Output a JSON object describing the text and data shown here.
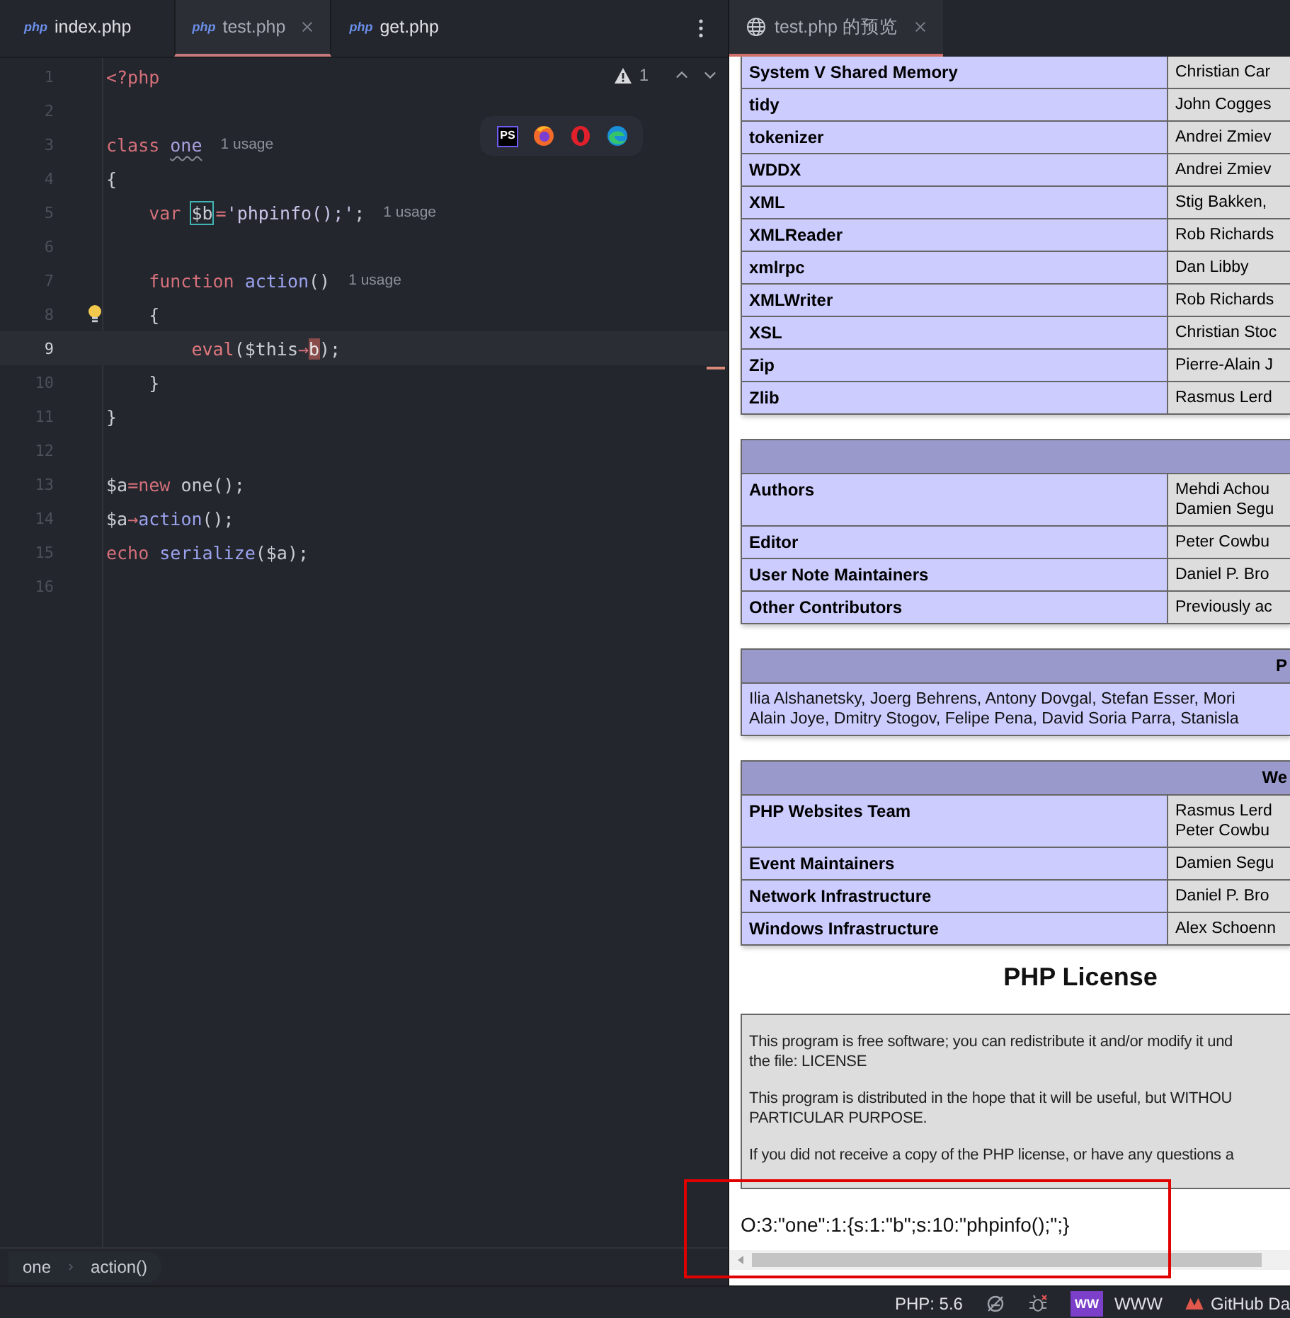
{
  "editor": {
    "tabs": [
      {
        "icon_text": "php",
        "label": "index.php",
        "selected": false,
        "closable": false
      },
      {
        "icon_text": "php",
        "label": "test.php",
        "selected": true,
        "closable": true
      },
      {
        "icon_text": "php",
        "label": "get.php",
        "selected": false,
        "closable": false
      }
    ],
    "inspection": {
      "warnings": "1"
    },
    "browser_toolbar": {
      "phpstorm_label": "PS"
    },
    "lines": [
      {
        "number": "1",
        "selected": false,
        "bulb": false,
        "tokens": [
          {
            "kind": "tag",
            "text": "<?php"
          }
        ]
      },
      {
        "number": "2",
        "selected": false,
        "bulb": false
      },
      {
        "number": "3",
        "selected": false,
        "bulb": false,
        "tokens": [
          {
            "kind": "kw",
            "text": "class "
          },
          {
            "kind": "cls",
            "text": "one"
          },
          {
            "kind": "hint",
            "text": "1 usage"
          }
        ]
      },
      {
        "number": "4",
        "selected": false,
        "bulb": false,
        "tokens": [
          {
            "kind": "plain",
            "text": "{"
          }
        ]
      },
      {
        "number": "5",
        "selected": false,
        "bulb": false,
        "tokens": [
          {
            "kind": "kw",
            "text": "    var "
          },
          {
            "kind": "boxed",
            "text": "$b"
          },
          {
            "kind": "op",
            "text": "="
          },
          {
            "kind": "str",
            "text": "'phpinfo();'"
          },
          {
            "kind": "plain",
            "text": ";"
          },
          {
            "kind": "hint",
            "text": "1 usage"
          }
        ]
      },
      {
        "number": "6",
        "selected": false,
        "bulb": false
      },
      {
        "number": "7",
        "selected": false,
        "bulb": false,
        "tokens": [
          {
            "kind": "kw",
            "text": "    function "
          },
          {
            "kind": "fn",
            "text": "action"
          },
          {
            "kind": "plain",
            "text": "()"
          },
          {
            "kind": "hint",
            "text": "1 usage"
          }
        ]
      },
      {
        "number": "8",
        "selected": false,
        "bulb": true,
        "tokens": [
          {
            "kind": "plain",
            "text": "    {"
          }
        ]
      },
      {
        "number": "9",
        "selected": true,
        "bulb": false,
        "tokens": [
          {
            "kind": "builtin",
            "text": "        eval"
          },
          {
            "kind": "plain",
            "text": "($this"
          },
          {
            "kind": "op",
            "text": "→"
          },
          {
            "kind": "caret",
            "text": "b"
          },
          {
            "kind": "plain",
            "text": ");"
          }
        ]
      },
      {
        "number": "10",
        "selected": false,
        "bulb": false,
        "tokens": [
          {
            "kind": "plain",
            "text": "    }"
          }
        ]
      },
      {
        "number": "11",
        "selected": false,
        "bulb": false,
        "tokens": [
          {
            "kind": "plain",
            "text": "}"
          }
        ]
      },
      {
        "number": "12",
        "selected": false,
        "bulb": false
      },
      {
        "number": "13",
        "selected": false,
        "bulb": false,
        "tokens": [
          {
            "kind": "plain",
            "text": "$a"
          },
          {
            "kind": "op",
            "text": "="
          },
          {
            "kind": "kw",
            "text": "new"
          },
          {
            "kind": "plain",
            "text": " one();"
          }
        ]
      },
      {
        "number": "14",
        "selected": false,
        "bulb": false,
        "tokens": [
          {
            "kind": "plain",
            "text": "$a"
          },
          {
            "kind": "op",
            "text": "→"
          },
          {
            "kind": "fn",
            "text": "action"
          },
          {
            "kind": "plain",
            "text": "();"
          }
        ]
      },
      {
        "number": "15",
        "selected": false,
        "bulb": false,
        "tokens": [
          {
            "kind": "kw",
            "text": "echo "
          },
          {
            "kind": "fn",
            "text": "serialize"
          },
          {
            "kind": "plain",
            "text": "($a);"
          }
        ]
      },
      {
        "number": "16",
        "selected": false,
        "bulb": false
      }
    ],
    "breadcrumbs": [
      "one",
      "action()"
    ]
  },
  "preview": {
    "tab": {
      "label": "test.php 的预览",
      "selected": true
    },
    "tables": [
      {
        "cut_top": true,
        "show_header": false,
        "rows": [
          {
            "name": "System V Shared Memory",
            "value": [
              "Christian Car"
            ]
          },
          {
            "name": "tidy",
            "value": [
              "John Cogges"
            ]
          },
          {
            "name": "tokenizer",
            "value": [
              "Andrei Zmiev"
            ]
          },
          {
            "name": "WDDX",
            "value": [
              "Andrei Zmiev"
            ]
          },
          {
            "name": "XML",
            "value": [
              "Stig Bakken,"
            ]
          },
          {
            "name": "XMLReader",
            "value": [
              "Rob Richards"
            ]
          },
          {
            "name": "xmlrpc",
            "value": [
              "Dan Libby"
            ]
          },
          {
            "name": "XMLWriter",
            "value": [
              "Rob Richards"
            ]
          },
          {
            "name": "XSL",
            "value": [
              "Christian Stoc"
            ]
          },
          {
            "name": "Zip",
            "value": [
              "Pierre-Alain J"
            ]
          },
          {
            "name": "Zlib",
            "value": [
              "Rasmus Lerd"
            ]
          }
        ]
      },
      {
        "cut_top": false,
        "show_header": true,
        "rows": [
          {
            "name": "Authors",
            "value": [
              "Mehdi Achou",
              "Damien Segu"
            ]
          },
          {
            "name": "Editor",
            "value": [
              "Peter Cowbu"
            ]
          },
          {
            "name": "User Note Maintainers",
            "value": [
              "Daniel P. Bro"
            ]
          },
          {
            "name": "Other Contributors",
            "value": [
              "Previously ac"
            ]
          }
        ]
      },
      {
        "cut_top": false,
        "header": "P",
        "show_header": true,
        "full_rows": [
          [
            "Ilia Alshanetsky, Joerg Behrens, Antony Dovgal, Stefan Esser, Mori",
            "Alain Joye, Dmitry Stogov, Felipe Pena, David Soria Parra, Stanisla"
          ]
        ]
      },
      {
        "cut_top": false,
        "header": "We",
        "show_header": true,
        "rows": [
          {
            "name": "PHP Websites Team",
            "value": [
              "Rasmus Lerd",
              "Peter Cowbu"
            ]
          },
          {
            "name": "Event Maintainers",
            "value": [
              "Damien Segu"
            ]
          },
          {
            "name": "Network Infrastructure",
            "value": [
              "Daniel P. Bro"
            ]
          },
          {
            "name": "Windows Infrastructure",
            "value": [
              "Alex Schoenn"
            ]
          }
        ]
      }
    ],
    "license": {
      "title": "PHP License",
      "paragraphs": [
        [
          "This program is free software; you can redistribute it and/or modify it und",
          "the file: LICENSE"
        ],
        [
          "This program is distributed in the hope that it will be useful, but WITHOU",
          "PARTICULAR PURPOSE."
        ],
        [
          "If you did not receive a copy of the PHP license, or have any questions a"
        ]
      ]
    },
    "output": "O:3:\"one\":1:{s:1:\"b\";s:10:\"phpinfo();\";}"
  },
  "status_bar": {
    "php_version": "PHP: 5.6",
    "ww_badge": "WW",
    "www_label": "WWW",
    "github_label": "GitHub Da"
  }
}
